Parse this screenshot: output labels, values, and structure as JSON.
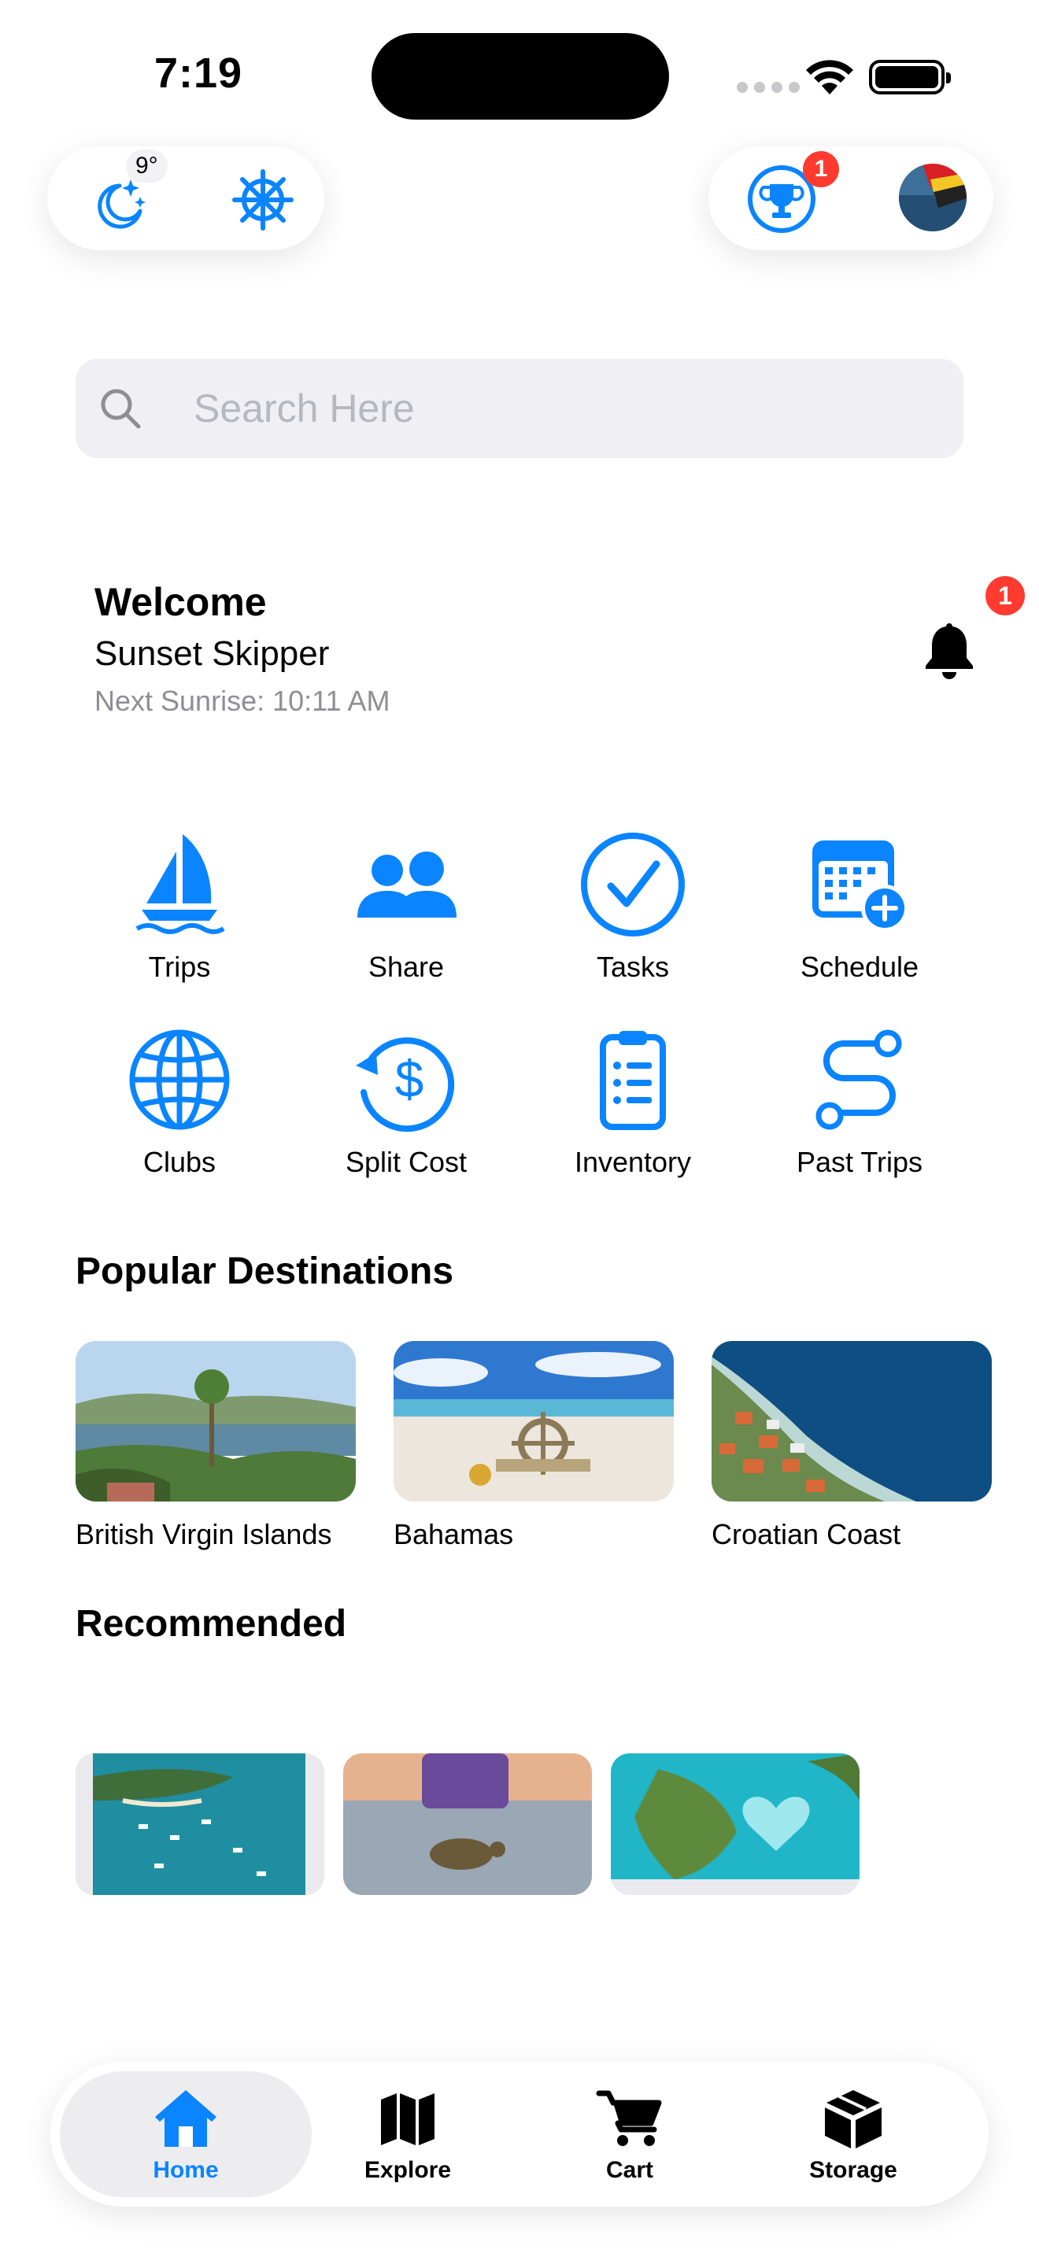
{
  "status": {
    "time": "7:19"
  },
  "top_left": {
    "temperature": "9°",
    "moon_icon": "moon-stars-icon",
    "helm_icon": "ship-wheel-icon"
  },
  "top_right": {
    "trophy_badge": "1",
    "trophy_icon": "trophy-icon",
    "avatar_icon": "avatar"
  },
  "search": {
    "placeholder": "Search Here"
  },
  "welcome": {
    "title": "Welcome",
    "name": "Sunset Skipper",
    "next_sunrise": "Next Sunrise: 10:11 AM",
    "bell_badge": "1"
  },
  "actions": [
    {
      "label": "Trips",
      "icon": "sailboat-icon"
    },
    {
      "label": "Share",
      "icon": "people-icon"
    },
    {
      "label": "Tasks",
      "icon": "checkmark-circle-icon"
    },
    {
      "label": "Schedule",
      "icon": "calendar-add-icon"
    },
    {
      "label": "Clubs",
      "icon": "globe-icon"
    },
    {
      "label": "Split Cost",
      "icon": "dollar-refresh-icon"
    },
    {
      "label": "Inventory",
      "icon": "clipboard-list-icon"
    },
    {
      "label": "Past Trips",
      "icon": "route-icon"
    }
  ],
  "popular": {
    "title": "Popular Destinations",
    "items": [
      {
        "label": "British Virgin Islands"
      },
      {
        "label": "Bahamas"
      },
      {
        "label": "Croatian Coast"
      }
    ]
  },
  "recommended": {
    "title": "Recommended"
  },
  "tabs": [
    {
      "label": "Home",
      "icon": "house-icon",
      "active": true
    },
    {
      "label": "Explore",
      "icon": "map-icon",
      "active": false
    },
    {
      "label": "Cart",
      "icon": "cart-icon",
      "active": false
    },
    {
      "label": "Storage",
      "icon": "box-icon",
      "active": false
    }
  ],
  "colors": {
    "accent": "#0a84ff",
    "badge": "#ff3b30",
    "search_bg": "#efeff4",
    "muted": "#8e8e93"
  }
}
